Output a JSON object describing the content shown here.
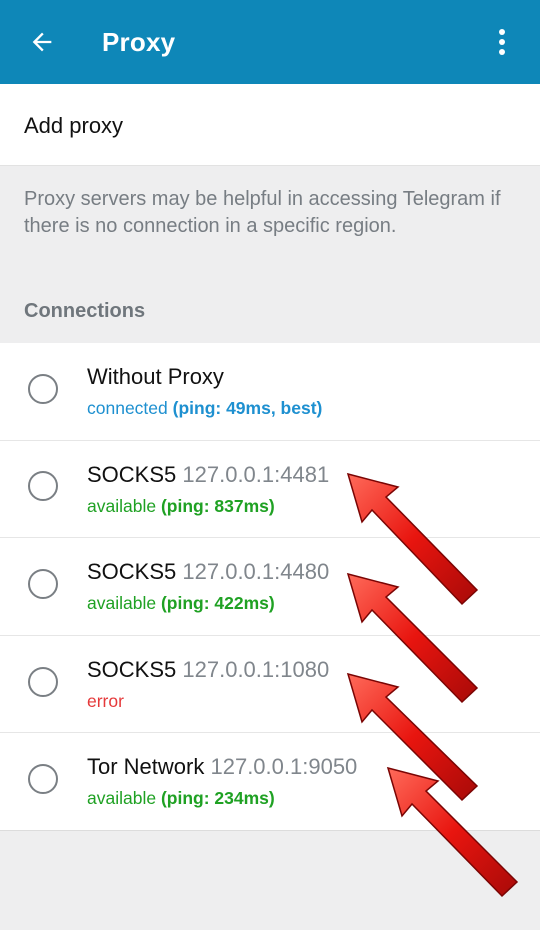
{
  "header": {
    "title": "Proxy",
    "back_icon": "arrow-left-icon",
    "menu_icon": "more-vertical-icon",
    "background": "#0e87b8"
  },
  "add_proxy": {
    "label": "Add proxy"
  },
  "info": {
    "text": "Proxy servers may be helpful in accessing Telegram if there is no connection in a specific region."
  },
  "connections": {
    "header": "Connections",
    "items": [
      {
        "type": "Without Proxy",
        "address": "",
        "status_prefix": "connected ",
        "status_ping": "(ping: 49ms, best)",
        "status_class": "connected",
        "selected": true
      },
      {
        "type": "SOCKS5",
        "address": "127.0.0.1:4481",
        "status_prefix": "available ",
        "status_ping": "(ping: 837ms)",
        "status_class": "available",
        "selected": false
      },
      {
        "type": "SOCKS5",
        "address": "127.0.0.1:4480",
        "status_prefix": "available ",
        "status_ping": "(ping: 422ms)",
        "status_class": "available",
        "selected": false
      },
      {
        "type": "SOCKS5",
        "address": "127.0.0.1:1080",
        "status_prefix": "error",
        "status_ping": "",
        "status_class": "error",
        "selected": false
      },
      {
        "type": "Tor Network",
        "address": "127.0.0.1:9050",
        "status_prefix": "available ",
        "status_ping": "(ping: 234ms)",
        "status_class": "available",
        "selected": false
      }
    ]
  },
  "colors": {
    "accent": "#22a3e8",
    "available": "#1fa123",
    "error": "#e5393a",
    "annotation_arrow": "#e0120f"
  }
}
